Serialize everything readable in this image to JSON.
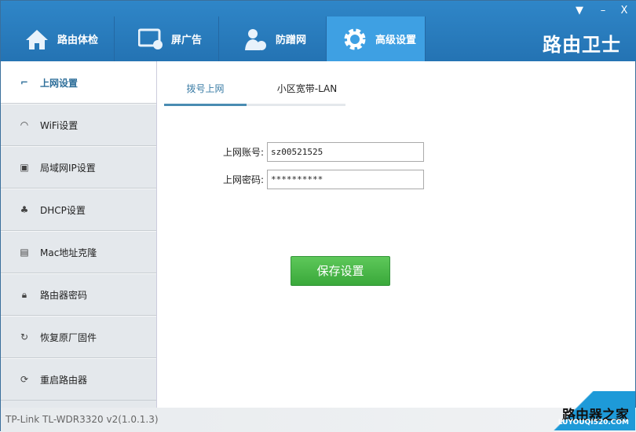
{
  "header": {
    "tabs": [
      {
        "label": "路由体检",
        "icon": "home-icon"
      },
      {
        "label": "屏广告",
        "icon": "ad-block-icon"
      },
      {
        "label": "防蹭网",
        "icon": "user-block-icon"
      },
      {
        "label": "高级设置",
        "icon": "gear-icon"
      }
    ],
    "brand": "路由卫士",
    "window": {
      "menu": "▼",
      "minimize": "–",
      "close": "X"
    }
  },
  "sidebar": {
    "items": [
      {
        "label": "上网设置",
        "icon": "cable-icon"
      },
      {
        "label": "WiFi设置",
        "icon": "wifi-icon"
      },
      {
        "label": "局域网IP设置",
        "icon": "lan-ip-icon"
      },
      {
        "label": "DHCP设置",
        "icon": "network-icon"
      },
      {
        "label": "Mac地址克隆",
        "icon": "mac-icon"
      },
      {
        "label": "路由器密码",
        "icon": "lock-icon"
      },
      {
        "label": "恢复原厂固件",
        "icon": "restore-icon"
      },
      {
        "label": "重启路由器",
        "icon": "reboot-icon"
      }
    ]
  },
  "content": {
    "tabs": [
      "拨号上网",
      "小区宽带-LAN"
    ],
    "account_label": "上网账号:",
    "account_value": "sz00521525",
    "password_label": "上网密码:",
    "password_value": "**********",
    "save_label": "保存设置"
  },
  "footer": {
    "version": "TP-Link TL-WDR3320 v2(1.0.1.3)"
  },
  "watermark": {
    "title": "路由器之家",
    "url": "LUYOUQI520.COM"
  },
  "colors": {
    "header": "#2a7cc0",
    "active_tab": "#3ea0e3",
    "save": "#4cb84a"
  }
}
